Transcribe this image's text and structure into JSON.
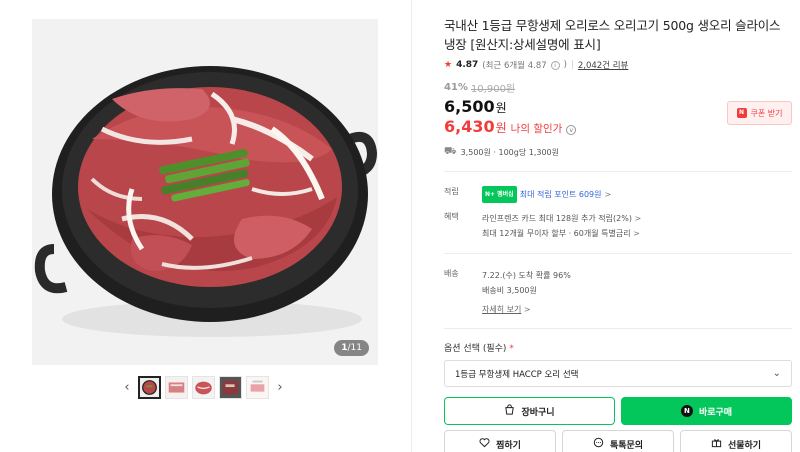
{
  "gallery": {
    "counter_current": "1",
    "counter_total": "/11",
    "prev_arrow": "‹",
    "next_arrow": "›"
  },
  "product": {
    "title": "국내산 1등급 무항생제 오리로스 오리고기 500g 생오리 슬라이스 냉장 [원산지:상세설명에 표시]",
    "rating_star": "★",
    "rating": "4.87",
    "rating_recent": "(최근 6개월 4.87",
    "rating_recent_close": ")",
    "info_icon": "i",
    "separator": "|",
    "review_count": "2,042건 리뷰",
    "discount_rate": "41%",
    "original_price": "10,900원",
    "price": "6,500",
    "price_unit": "원",
    "my_price": "6,430",
    "my_price_unit": "원",
    "my_price_label": "나의 할인가",
    "chevron_down": "v",
    "coupon_label": "쿠폰 받기",
    "coupon_icon": "N",
    "shipping_summary": "3,500원 · 100g당 1,300원"
  },
  "benefits": {
    "points_label": "적립",
    "npay_badge": "N+ 멤버십",
    "points_text": "최대 적립 포인트 609원",
    "chevron": ">",
    "benefit_label": "혜택",
    "card_text": "라인프렌즈 카드 최대 128원 추가 적립(2%)",
    "installment_text": "최대 12개월 무이자 할부 · 60개월 특별금리"
  },
  "delivery": {
    "label": "배송",
    "arrival": "7.22.(수) 도착 확률 96%",
    "fee": "배송비 3,500원",
    "details_link": "자세히 보기"
  },
  "options": {
    "label": "옵션 선택 (필수)",
    "required_mark": "*",
    "selected": "1등급 무항생제 HACCP 오리 선택",
    "dropdown_chevron": "⌄"
  },
  "actions": {
    "cart": "장바구니",
    "buy": "바로구매",
    "buy_icon": "N",
    "wish": "찜하기",
    "talk": "톡톡문의",
    "gift": "선물하기"
  },
  "colors": {
    "accent_red": "#f23b3b",
    "naver_green": "#03c75a"
  }
}
